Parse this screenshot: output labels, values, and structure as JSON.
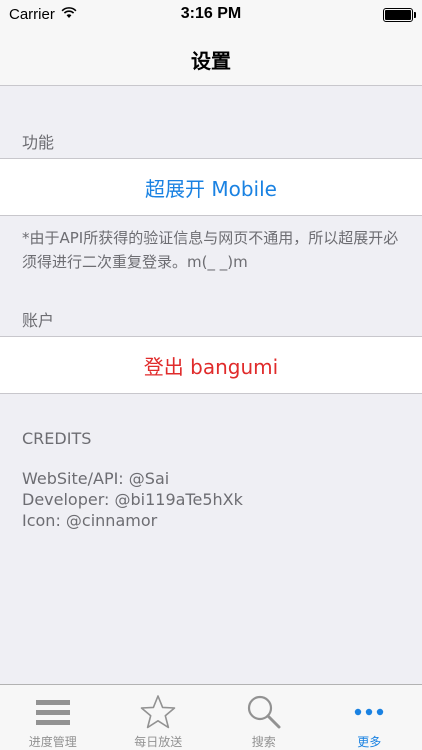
{
  "status_bar": {
    "carrier": "Carrier",
    "time": "3:16 PM"
  },
  "nav": {
    "title": "设置"
  },
  "features": {
    "header": "功能",
    "action_label": "超展开 Mobile",
    "footnote": "*由于API所获得的验证信息与网页不通用，所以超展开必须得进行二次重复登录。m(_ _)m"
  },
  "account": {
    "header": "账户",
    "logout_label": "登出 bangumi"
  },
  "credits": {
    "title": "CREDITS",
    "lines": [
      "WebSite/API: @Sai",
      "Developer: @bi119aTe5hXk",
      "Icon: @cinnamor"
    ]
  },
  "tabs": [
    {
      "label": "进度管理",
      "icon": "list-icon"
    },
    {
      "label": "每日放送",
      "icon": "star-icon"
    },
    {
      "label": "搜索",
      "icon": "search-icon"
    },
    {
      "label": "更多",
      "icon": "more-icon"
    }
  ],
  "colors": {
    "accent": "#1a82e2",
    "destructive": "#e02b2b",
    "background": "#efeff4"
  }
}
